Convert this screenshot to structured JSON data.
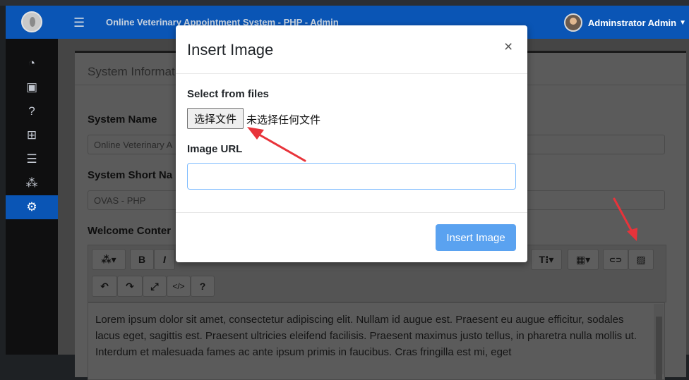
{
  "app": {
    "title": "Online Veterinary Appointment System - PHP - Admin",
    "user_name": "Adminstrator Admin"
  },
  "sidebar": {
    "items": [
      {
        "icon": "dashboard-icon",
        "glyph": "◔",
        "active": false
      },
      {
        "icon": "calendar-icon",
        "glyph": "▣",
        "active": false
      },
      {
        "icon": "question-icon",
        "glyph": "?",
        "active": false
      },
      {
        "icon": "table-icon",
        "glyph": "⊞",
        "active": false
      },
      {
        "icon": "list-icon",
        "glyph": "☰",
        "active": false
      },
      {
        "icon": "users-icon",
        "glyph": "⁂",
        "active": false
      },
      {
        "icon": "settings-icon",
        "glyph": "⚙",
        "active": true
      }
    ]
  },
  "page": {
    "card_title": "System Informat",
    "system_name_label": "System Name",
    "system_name_value": "Online Veterinary A",
    "short_name_label": "System Short Na",
    "short_name_value": "OVAS - PHP",
    "welcome_label": "Welcome Conter",
    "editor_text": "Lorem ipsum dolor sit amet, consectetur adipiscing elit. Nullam id augue est. Praesent eu augue efficitur, sodales lacus eget, sagittis est. Praesent ultricies eleifend facilisis. Praesent maximus justo tellus, in pharetra nulla mollis ut. Interdum et malesuada fames ac ante ipsum primis in faucibus. Cras fringilla est mi, eget"
  },
  "toolbar": {
    "row1": [
      {
        "name": "magic-button",
        "glyph": "⁂▾"
      },
      {
        "name": "bold-button",
        "glyph": "B"
      },
      {
        "name": "italic-button",
        "glyph": "I"
      },
      {
        "name": "paragraph-button",
        "glyph": "T⁝▾"
      },
      {
        "name": "table-button",
        "glyph": "▦▾"
      },
      {
        "name": "link-button",
        "glyph": "⊂⊃"
      },
      {
        "name": "picture-button",
        "glyph": "▨"
      }
    ],
    "row2": [
      {
        "name": "undo-button",
        "glyph": "↶"
      },
      {
        "name": "redo-button",
        "glyph": "↷"
      },
      {
        "name": "fullscreen-button",
        "glyph": "⤢"
      },
      {
        "name": "codeview-button",
        "glyph": "</>"
      },
      {
        "name": "help-button",
        "glyph": "?"
      }
    ]
  },
  "modal": {
    "title": "Insert Image",
    "close": "×",
    "select_label": "Select from files",
    "file_button": "选择文件",
    "file_status": "未选择任何文件",
    "url_label": "Image URL",
    "url_value": "",
    "submit": "Insert Image"
  },
  "colors": {
    "header": "#0a55b5",
    "primary_button": "#5aa2f0",
    "annotation_arrow": "#e8333a"
  }
}
